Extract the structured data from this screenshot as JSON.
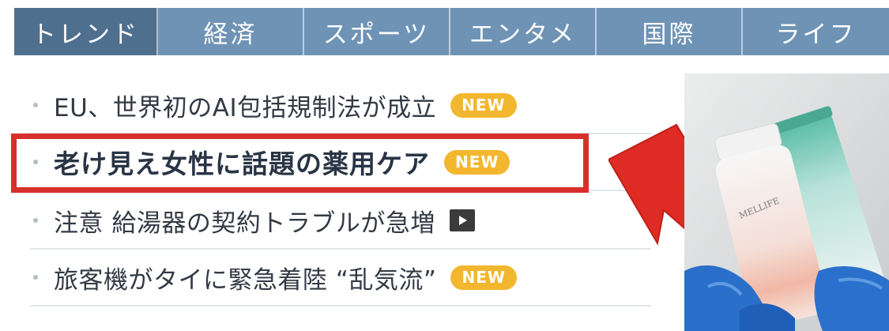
{
  "tabs": [
    {
      "label": "トレンド"
    },
    {
      "label": "経済"
    },
    {
      "label": "スポーツ"
    },
    {
      "label": "エンタメ"
    },
    {
      "label": "国際"
    },
    {
      "label": "ライフ"
    }
  ],
  "news": [
    {
      "title": "EU、世界初のAI包括規制法が成立",
      "badge": "NEW"
    },
    {
      "title": "老け見え女性に話題の薬用ケア",
      "badge": "NEW"
    },
    {
      "title": "注意 給湯器の契約トラブルが急増",
      "marker": "play-video-icon"
    },
    {
      "title": "旅客機がタイに緊急着陸 “乱気流”",
      "badge": "NEW"
    }
  ],
  "product": {
    "brand": "MELLIFE"
  },
  "colors": {
    "tab_bg": "#6f93b5",
    "tab_active_bg": "#4f6f8f",
    "badge": "#f2b72e",
    "highlight": "#d7302c"
  }
}
